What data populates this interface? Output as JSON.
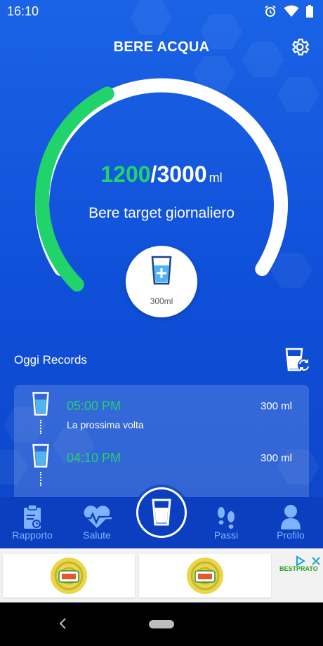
{
  "status_bar": {
    "time": "16:10",
    "icons": [
      "alarm-icon",
      "wifi-icon",
      "battery-icon"
    ]
  },
  "header": {
    "title": "BERE ACQUA",
    "settings_icon": "gear-icon"
  },
  "progress": {
    "current": "1200",
    "separator": "/",
    "target": "3000",
    "unit": "ml",
    "label": "Bere target giornaliero",
    "fraction": 0.4
  },
  "add_cup": {
    "icon": "cup-plus-icon",
    "size": "300ml"
  },
  "records": {
    "title": "Oggi Records",
    "switch_icon": "cup-refresh-icon",
    "items": [
      {
        "time": "05:00 PM",
        "amount": "300 ml",
        "note": "La prossima volta"
      },
      {
        "time": "04:10 PM",
        "amount": "300 ml",
        "note": ""
      }
    ]
  },
  "bottom_nav": {
    "items": [
      {
        "label": "Rapporto",
        "icon": "clipboard-chart-icon"
      },
      {
        "label": "Salute",
        "icon": "heart-pulse-icon"
      },
      {
        "label": "Passi",
        "icon": "footsteps-icon"
      },
      {
        "label": "Profilo",
        "icon": "person-icon"
      }
    ],
    "center_icon": "water-glass-icon"
  },
  "ad": {
    "brand": "BESTPRATO"
  },
  "colors": {
    "accent_green": "#20d36a",
    "background_blue": "#0f4fd8",
    "nav_blue": "#0b3fc0"
  }
}
